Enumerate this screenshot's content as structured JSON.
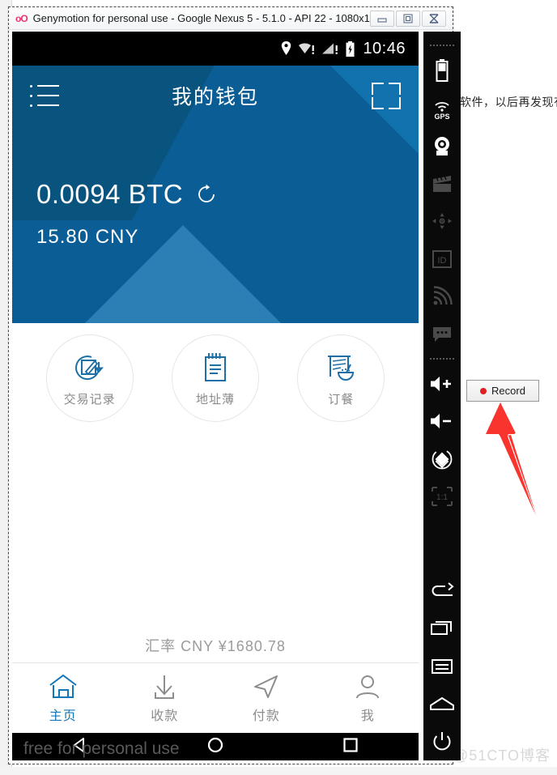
{
  "window": {
    "logo": "oO",
    "title": "Genymotion for personal use - Google Nexus 5 - 5.1.0 - API 22 - 1080x1...",
    "controls": [
      {
        "name": "minimize",
        "glyph": "—"
      },
      {
        "name": "restore",
        "glyph": "❐"
      },
      {
        "name": "close",
        "glyph": "✕"
      }
    ]
  },
  "desktop": {
    "background_text_right": "软件，以后再发现有",
    "watermark": "@51CTO博客"
  },
  "android": {
    "status_bar": {
      "clock": "10:46",
      "icons": [
        "location-pin-icon",
        "wifi-warning-icon",
        "signal-warning-icon",
        "battery-charging-icon"
      ]
    },
    "nav_bar": {
      "buttons": [
        "back-button",
        "home-button",
        "recents-button"
      ],
      "watermark": "free for personal use"
    }
  },
  "app": {
    "appbar": {
      "title": "我的钱包",
      "menu_icon": "list-menu-icon",
      "scan_icon": "qr-scan-icon"
    },
    "balance": {
      "primary": "0.0094 BTC",
      "secondary": "15.80  CNY",
      "refresh_icon": "refresh-icon"
    },
    "quick_actions": [
      {
        "label": "交易记录",
        "icon": "transaction-history-icon"
      },
      {
        "label": "地址薄",
        "icon": "address-book-icon"
      },
      {
        "label": "订餐",
        "icon": "order-food-icon"
      }
    ],
    "rate_bar": {
      "text": "汇率  CNY ¥1680.78"
    },
    "tabs": [
      {
        "label": "主页",
        "icon": "home-icon",
        "active": true
      },
      {
        "label": "收款",
        "icon": "receive-icon",
        "active": false
      },
      {
        "label": "付款",
        "icon": "send-icon",
        "active": false
      },
      {
        "label": "我",
        "icon": "profile-icon",
        "active": false
      }
    ],
    "colors": {
      "header_blue": "#0b5d96",
      "accent_blue": "#1277b8",
      "muted_gray": "#8d8d8d"
    }
  },
  "genymotion_toolbar": [
    {
      "name": "battery-widget-icon",
      "dim": false
    },
    {
      "name": "gps-widget-icon",
      "dim": false
    },
    {
      "name": "camera-widget-icon",
      "dim": false
    },
    {
      "name": "video-recorder-icon",
      "dim": true
    },
    {
      "name": "dpad-icon",
      "dim": true
    },
    {
      "name": "identifiers-icon",
      "dim": true
    },
    {
      "name": "network-signal-icon",
      "dim": true
    },
    {
      "name": "sms-bubble-icon",
      "dim": true
    },
    {
      "name": "volume-up-icon",
      "dim": false
    },
    {
      "name": "volume-down-icon",
      "dim": false
    },
    {
      "name": "rotate-screen-icon",
      "dim": false
    },
    {
      "name": "scale-one-to-one-icon",
      "dim": true
    },
    {
      "name": "back-icon",
      "dim": false
    },
    {
      "name": "recents-icon",
      "dim": false
    },
    {
      "name": "menu-icon",
      "dim": false
    },
    {
      "name": "home-icon",
      "dim": false
    },
    {
      "name": "power-icon",
      "dim": false
    }
  ],
  "annotation": {
    "record_label": "Record",
    "arrow_color": "#f9332e",
    "record_dot_color": "#e02020"
  }
}
